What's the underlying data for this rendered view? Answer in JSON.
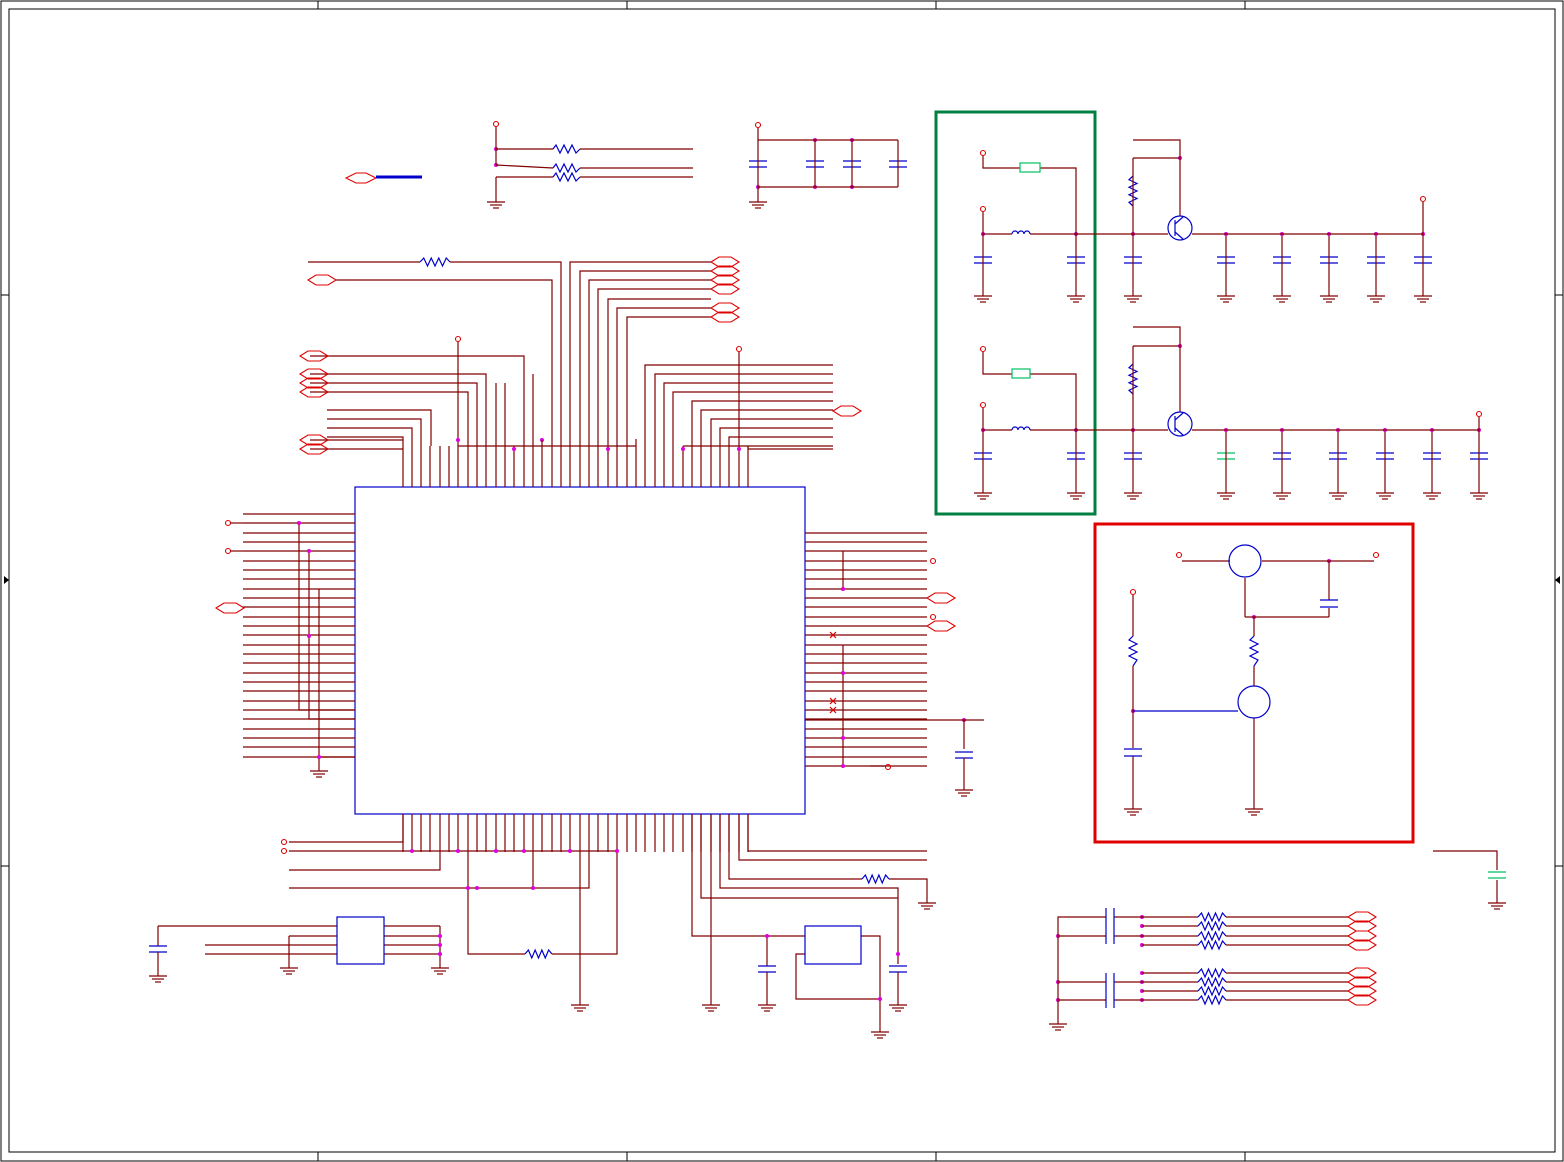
{
  "sheet": {
    "colors": {
      "wire": "#800000",
      "component": "#0000cc",
      "net_port": "#e00000",
      "junction": "#e000e0",
      "power_section_highlight": "#008040",
      "switch_section_highlight": "#e00000",
      "ferrite": "#00c060"
    },
    "blocks": [
      {
        "id": "main-ic",
        "label": ""
      },
      {
        "id": "regulator-section",
        "label": ""
      },
      {
        "id": "power-switch-section",
        "label": ""
      }
    ]
  }
}
